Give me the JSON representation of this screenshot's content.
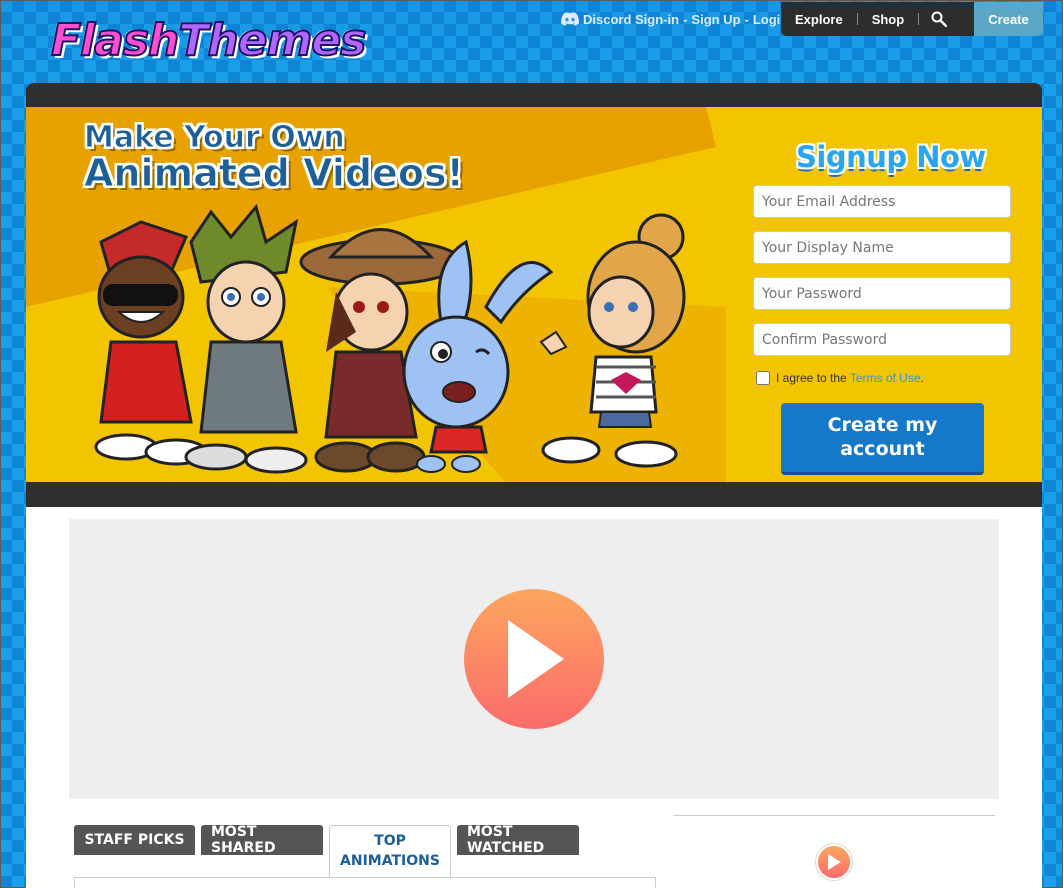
{
  "logo": {
    "part1": "Flash",
    "part2": "Themes"
  },
  "auth": {
    "discord": "Discord Sign-in",
    "sep1": "-",
    "signup": "Sign Up",
    "sep2": "-",
    "login": "Login"
  },
  "nav": {
    "explore": "Explore",
    "shop": "Shop",
    "create": "Create"
  },
  "hero": {
    "headline_line1": "Make Your Own",
    "headline_line2": "Animated Videos!"
  },
  "signup": {
    "title": "Signup Now",
    "email_placeholder": "Your Email Address",
    "display_name_placeholder": "Your Display Name",
    "password_placeholder": "Your Password",
    "confirm_placeholder": "Confirm Password",
    "terms_prefix": "I agree to the",
    "terms_link": "Terms of Use",
    "terms_suffix": ".",
    "button_line1": "Create my",
    "button_line2": "account"
  },
  "tabs": [
    {
      "label": "STAFF PICKS"
    },
    {
      "label": "MOST SHARED"
    },
    {
      "label_line1": "TOP",
      "label_line2": "ANIMATIONS"
    },
    {
      "label": "MOST WATCHED"
    }
  ],
  "colors": {
    "accent_blue": "#1578c8",
    "hero_yellow": "#f3c400",
    "play_orange": "#fca65e",
    "play_red": "#fb6b6b",
    "topnav_dark": "#2d2d2d",
    "create_teal": "#5aa7c6"
  },
  "icons": [
    "discord-icon",
    "search-icon",
    "play-icon"
  ]
}
